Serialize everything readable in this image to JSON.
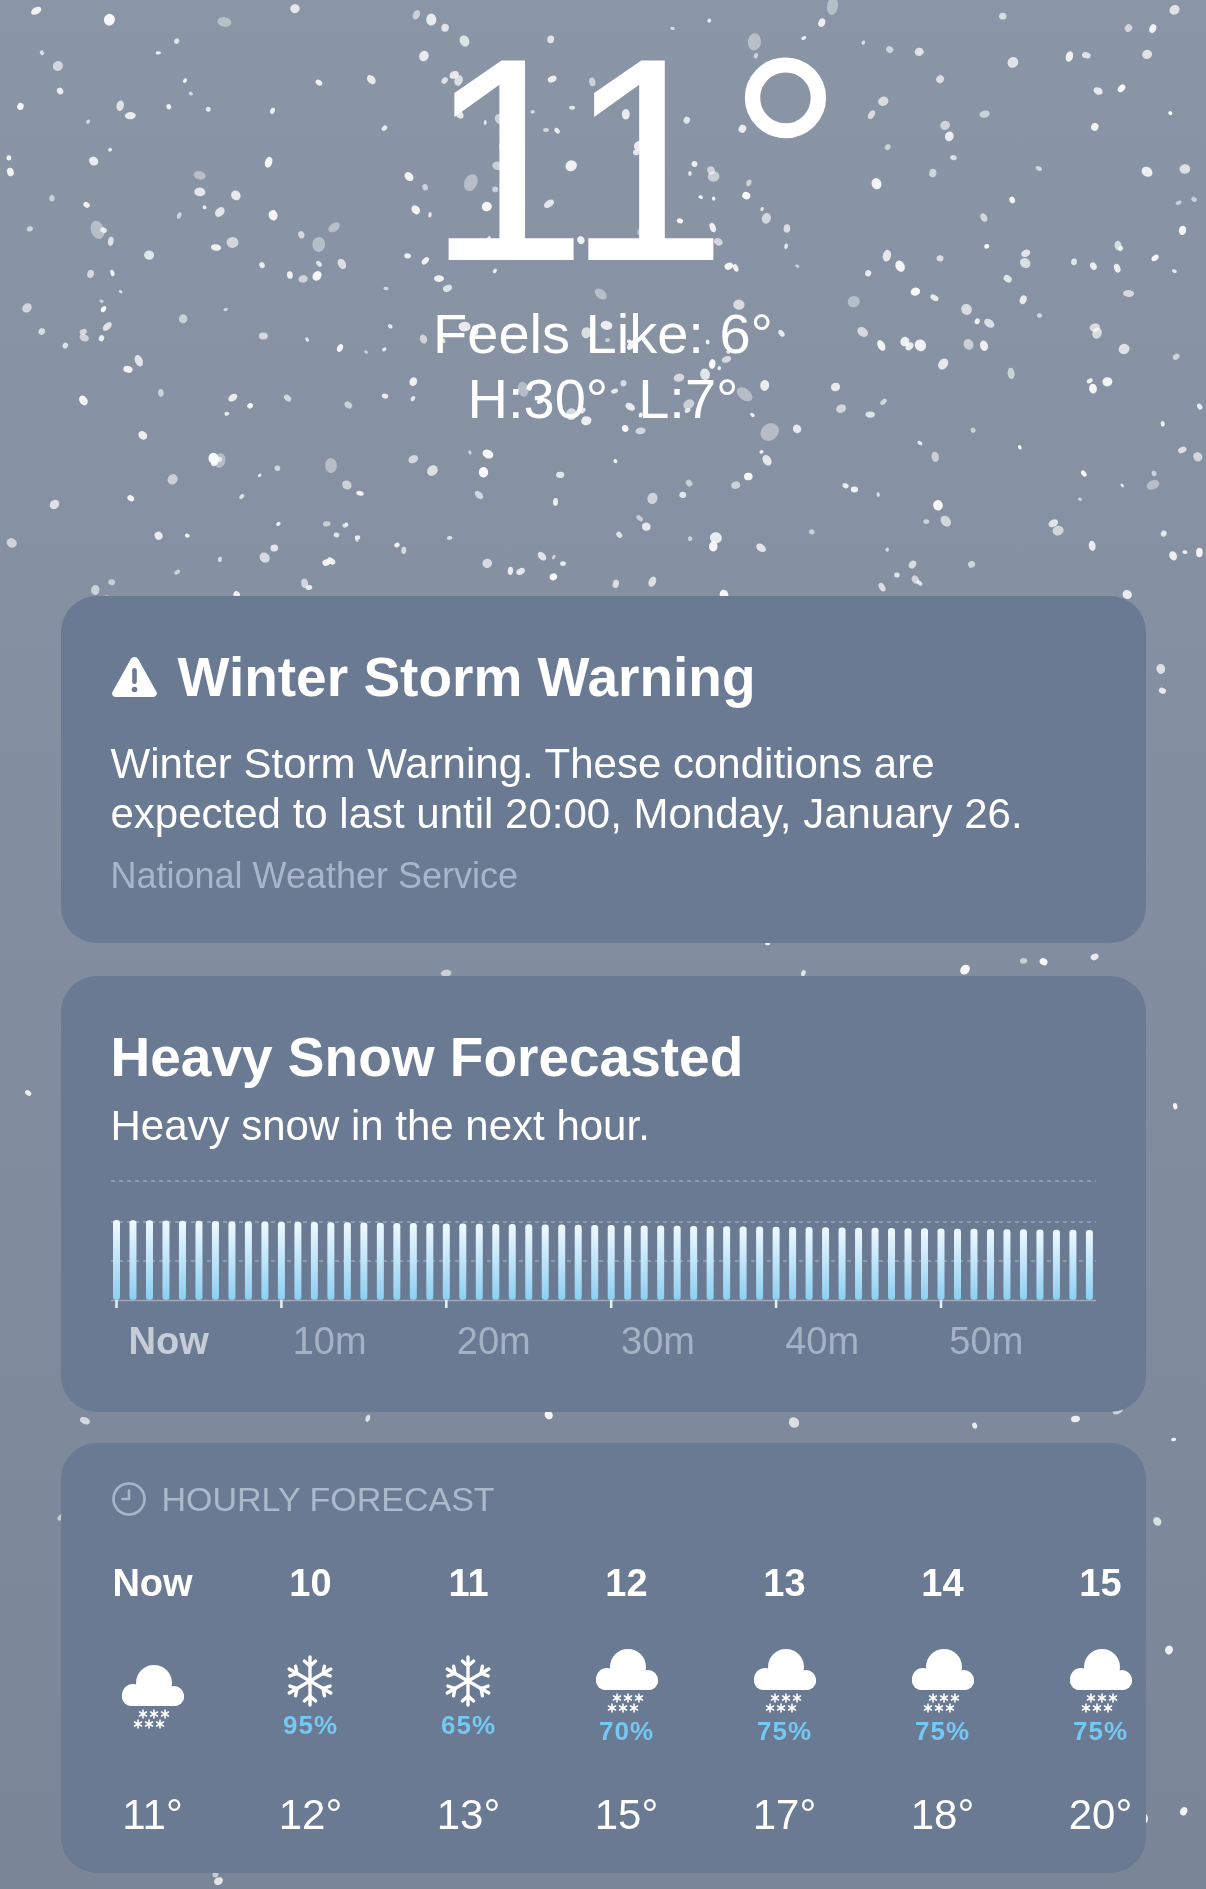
{
  "current": {
    "temperature": "11°",
    "feels_like": "Feels Like: 6°",
    "high": "H:30°",
    "low": "L:7°"
  },
  "alert": {
    "title": "Winter Storm Warning",
    "body": "Winter Storm Warning. These conditions are expected to last until 20:00, Monday, January 26.",
    "source": "National Weather Service"
  },
  "precipitation": {
    "title": "Heavy Snow Forecasted",
    "summary": "Heavy snow in the next hour.",
    "axis_labels": [
      {
        "label": "Now",
        "current": true
      },
      {
        "label": "10m",
        "current": false
      },
      {
        "label": "20m",
        "current": false
      },
      {
        "label": "30m",
        "current": false
      },
      {
        "label": "40m",
        "current": false
      },
      {
        "label": "50m",
        "current": false
      }
    ]
  },
  "hourly": {
    "header": "HOURLY FORECAST",
    "hours": [
      {
        "time": "Now",
        "kind": "cloud",
        "temperature": "11°"
      },
      {
        "time": "10",
        "kind": "snowflake",
        "chance": "95%",
        "temperature": "12°"
      },
      {
        "time": "11",
        "kind": "snowflake",
        "chance": "65%",
        "temperature": "13°"
      },
      {
        "time": "12",
        "kind": "cloud",
        "chance": "70%",
        "temperature": "15°"
      },
      {
        "time": "13",
        "kind": "cloud",
        "chance": "75%",
        "temperature": "17°"
      },
      {
        "time": "14",
        "kind": "cloud",
        "chance": "75%",
        "temperature": "18°"
      },
      {
        "time": "15",
        "kind": "cloud",
        "chance": "75%",
        "temperature": "20°"
      }
    ]
  }
}
